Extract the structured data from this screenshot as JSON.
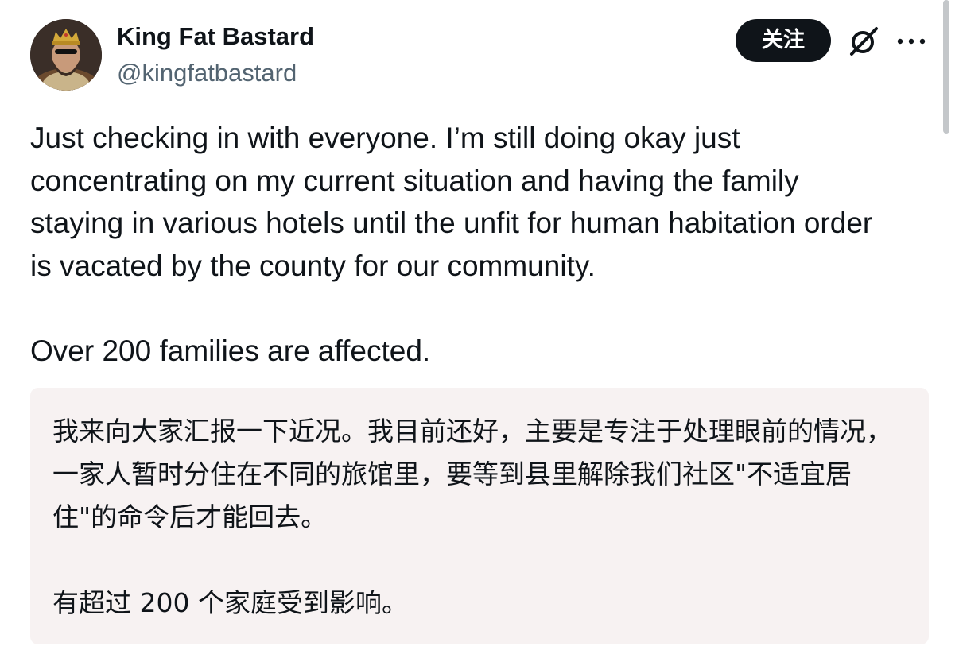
{
  "author": {
    "display_name": "King Fat Bastard",
    "handle": "@kingfatbastard",
    "avatar_icon": "crowned-king-avatar"
  },
  "actions": {
    "follow_label": "关注",
    "grok_icon": "grok-icon",
    "more_icon": "more-horizontal-icon"
  },
  "tweet": {
    "paragraph_1": "Just checking in with everyone. I’m still doing okay just concentrating on my current situation and having the family staying in various hotels until the unfit for human habitation order is vacated by the county for our community.",
    "paragraph_2": "Over 200 families are affected."
  },
  "translation": {
    "paragraph_1": "我来向大家汇报一下近况。我目前还好，主要是专注于处理眼前的情况，一家人暂时分住在不同的旅馆里，要等到县里解除我们社区\"不适宜居住\"的命令后才能回去。",
    "paragraph_2": "有超过 200 个家庭受到影响。"
  },
  "colors": {
    "text_primary": "#0f1419",
    "text_secondary": "#536471",
    "follow_bg": "#0f1419",
    "translation_bg": "#f7f2f2"
  }
}
